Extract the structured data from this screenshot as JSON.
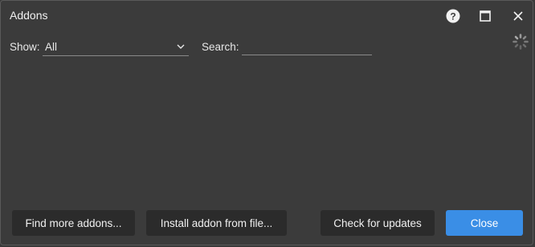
{
  "window": {
    "title": "Addons",
    "buttons": {
      "help_icon": "question-circle-icon",
      "maximize_icon": "maximize-icon",
      "close_icon": "close-icon"
    }
  },
  "filter": {
    "show_label": "Show:",
    "show_value": "All",
    "search_label": "Search:",
    "search_value": "",
    "search_placeholder": ""
  },
  "footer": {
    "find_more": "Find more addons...",
    "install_from_file": "Install addon from file...",
    "check_updates": "Check for updates",
    "close": "Close"
  },
  "colors": {
    "background": "#3b3b3b",
    "button": "#2b2b2b",
    "primary_button": "#3a8ee6"
  }
}
